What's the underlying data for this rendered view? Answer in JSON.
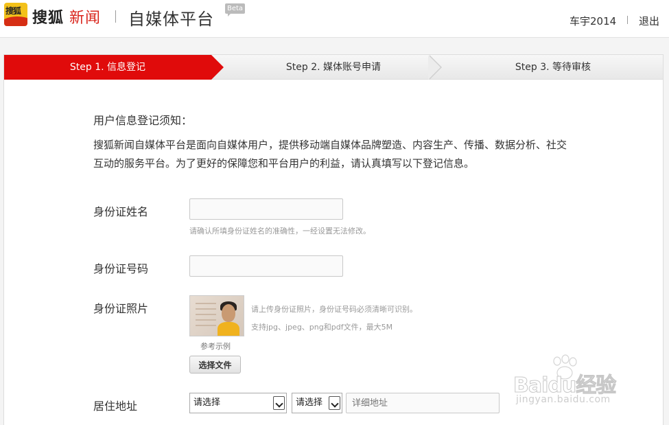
{
  "header": {
    "brand_sohu": "搜狐",
    "brand_news": "新闻",
    "platform_name": "自媒体平台",
    "beta_badge": "Beta",
    "username": "车宇2014",
    "logout_label": "退出"
  },
  "steps": [
    {
      "label": "Step 1. 信息登记",
      "active": true
    },
    {
      "label": "Step 2. 媒体账号申请",
      "active": false
    },
    {
      "label": "Step 3. 等待审核",
      "active": false
    }
  ],
  "notice": {
    "title": "用户信息登记须知：",
    "body": "搜狐新闻自媒体平台是面向自媒体用户，提供移动端自媒体品牌塑造、内容生产、传播、数据分析、社交互动的服务平台。为了更好的保障您和平台用户的利益，请认真填写以下登记信息。"
  },
  "form": {
    "id_name": {
      "label": "身份证姓名",
      "value": "",
      "hint": "请确认所填身份证姓名的准确性，一经设置无法修改。"
    },
    "id_number": {
      "label": "身份证号码",
      "value": ""
    },
    "id_photo": {
      "label": "身份证照片",
      "hint1": "请上传身份证照片，身份证号码必须清晰可识别。",
      "hint2": "支持jpg、jpeg、png和pdf文件，最大5M",
      "sample_caption": "参考示例",
      "upload_button": "选择文件"
    },
    "address": {
      "label": "居住地址",
      "province": "请选择",
      "city": "请选择",
      "detail_placeholder": "详细地址"
    }
  },
  "watermark": {
    "brand": "Baidu经验",
    "url": "jingyan.baidu.com"
  },
  "colors": {
    "accent_red": "#e00b0b",
    "brand_red": "#d9251c",
    "logo_yellow": "#f3c11a"
  }
}
